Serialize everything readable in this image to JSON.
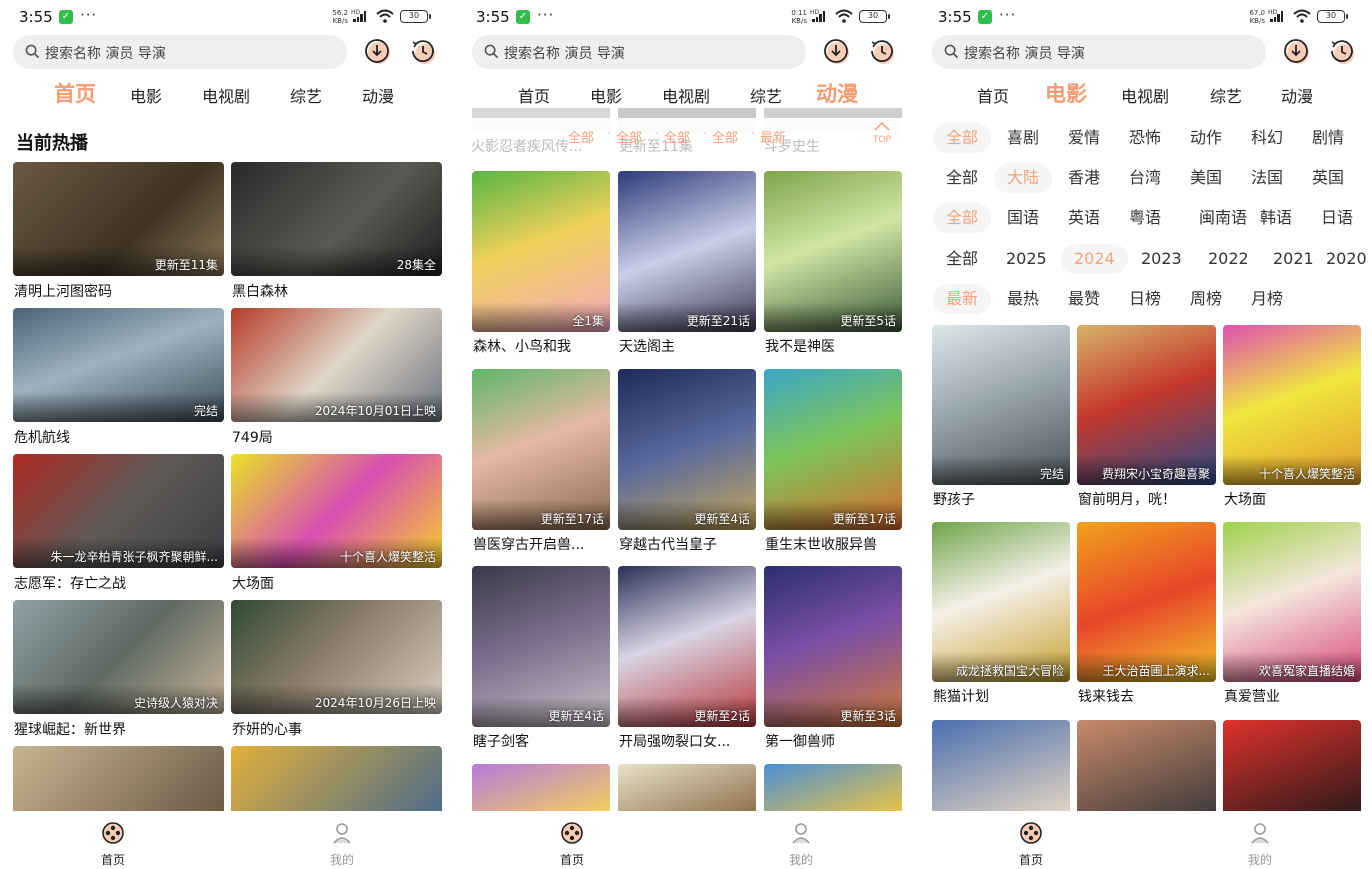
{
  "status": [
    {
      "time": "3:55",
      "rate_top": "56.2",
      "rate_bot": "KB/s",
      "battery": "30"
    },
    {
      "time": "3:55",
      "rate_top": "0.11",
      "rate_bot": "KB/s",
      "battery": "30"
    },
    {
      "time": "3:55",
      "rate_top": "67.0",
      "rate_bot": "KB/s",
      "battery": "30"
    }
  ],
  "status_hd": "HD",
  "status_dots": "···",
  "search": {
    "placeholder": "搜索名称 演员 导演"
  },
  "tabs": [
    "首页",
    "电影",
    "电视剧",
    "综艺",
    "动漫"
  ],
  "home": {
    "section_title": "当前热播",
    "cards": [
      {
        "title": "清明上河图密码",
        "badge": "更新至11集"
      },
      {
        "title": "黑白森林",
        "badge": "28集全"
      },
      {
        "title": "危机航线",
        "badge": "完结"
      },
      {
        "title": "749局",
        "badge": "2024年10月01日上映"
      },
      {
        "title": "志愿军：存亡之战",
        "badge": "朱一龙辛柏青张子枫齐聚朝鲜..."
      },
      {
        "title": "大场面",
        "badge": "十个喜人爆笑整活"
      },
      {
        "title": "猩球崛起：新世界",
        "badge": "史诗级人猿对决"
      },
      {
        "title": "乔妍的心事",
        "badge": "2024年10月26日上映"
      }
    ]
  },
  "anime": {
    "filter_chips": [
      "全部",
      "全部",
      "全部",
      "全部",
      "最新"
    ],
    "top_label": "TOP",
    "ghost_titles": [
      "火影忍者疾风传...",
      "更新至11集",
      "斗罗史生"
    ],
    "cards": [
      {
        "title": "森林、小鸟和我",
        "badge": "全1集"
      },
      {
        "title": "天选阁主",
        "badge": "更新至21话"
      },
      {
        "title": "我不是神医",
        "badge": "更新至5话"
      },
      {
        "title": "兽医穿古开启兽...",
        "badge": "更新至17话"
      },
      {
        "title": "穿越古代当皇子",
        "badge": "更新至4话"
      },
      {
        "title": "重生末世收服异兽",
        "badge": "更新至17话"
      },
      {
        "title": "瞎子剑客",
        "badge": "更新至4话"
      },
      {
        "title": "开局强吻裂口女...",
        "badge": "更新至2话"
      },
      {
        "title": "第一御兽师",
        "badge": "更新至3话"
      }
    ]
  },
  "movie": {
    "filters": [
      {
        "items": [
          "全部",
          "喜剧",
          "爱情",
          "恐怖",
          "动作",
          "科幻",
          "剧情"
        ],
        "selected": 0
      },
      {
        "items": [
          "全部",
          "大陆",
          "香港",
          "台湾",
          "美国",
          "法国",
          "英国"
        ],
        "selected": 1
      },
      {
        "items": [
          "全部",
          "国语",
          "英语",
          "粤语",
          "闽南语",
          "韩语",
          "日语"
        ],
        "selected": 0
      },
      {
        "items": [
          "全部",
          "2025",
          "2024",
          "2023",
          "2022",
          "2021",
          "2020"
        ],
        "selected": 2
      },
      {
        "items": [
          "最新",
          "最热",
          "最赞",
          "日榜",
          "周榜",
          "月榜"
        ],
        "selected": 0
      }
    ],
    "cards": [
      {
        "title": "野孩子",
        "badge": "完结"
      },
      {
        "title": "窗前明月，咣！",
        "badge": "费翔宋小宝奇趣喜聚"
      },
      {
        "title": "大场面",
        "badge": "十个喜人爆笑整活"
      },
      {
        "title": "熊猫计划",
        "badge": "成龙拯救国宝大冒险"
      },
      {
        "title": "钱来钱去",
        "badge": "王大治苗圃上演求..."
      },
      {
        "title": "真爱营业",
        "badge": "欢喜冤家直播结婚"
      }
    ]
  },
  "bottom_nav": {
    "home": "首页",
    "mine": "我的"
  },
  "colors": {
    "accent": "#f39b73",
    "wechat_badge": "#2fbf4a",
    "search_bg": "#efefef"
  }
}
